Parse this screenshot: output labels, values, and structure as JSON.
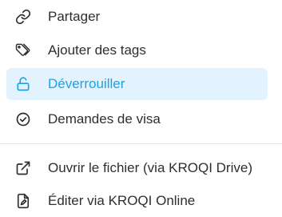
{
  "colors": {
    "text": "#2b2f33",
    "accent": "#1aa3e8",
    "active_bg": "#e3f3fd",
    "divider": "#e6e8eb"
  },
  "menu": {
    "items": [
      {
        "label": "Partager",
        "icon": "link-icon",
        "active": false
      },
      {
        "label": "Ajouter des tags",
        "icon": "tags-icon",
        "active": false
      },
      {
        "label": "Déverrouiller",
        "icon": "unlock-icon",
        "active": true
      },
      {
        "label": "Demandes de visa",
        "icon": "check-circle-icon",
        "active": false
      }
    ],
    "secondary_items": [
      {
        "label": "Ouvrir le fichier (via KROQI Drive)",
        "icon": "external-link-icon",
        "active": false
      },
      {
        "label": "Éditer via KROQI Online",
        "icon": "edit-document-icon",
        "active": false
      }
    ]
  }
}
